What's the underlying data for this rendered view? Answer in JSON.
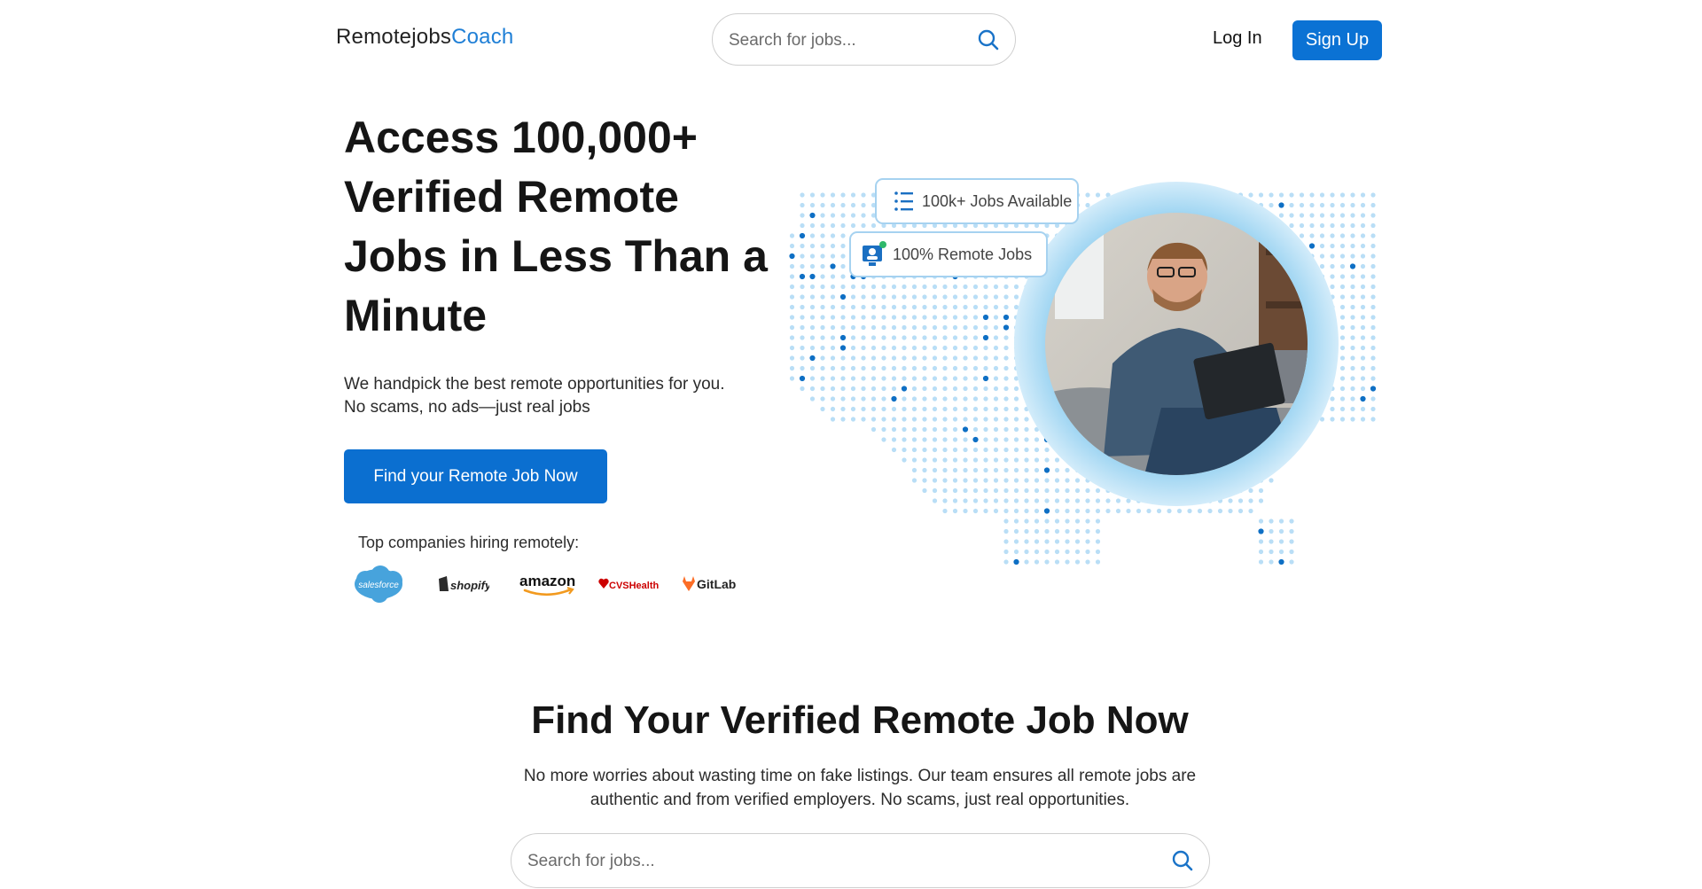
{
  "header": {
    "logo_part1": "Remotejobs",
    "logo_part2": "Coach",
    "search_placeholder": "Search for jobs...",
    "login_label": "Log In",
    "signup_label": "Sign Up"
  },
  "hero": {
    "title": "Access 100,000+ Verified Remote Jobs in Less Than a Minute",
    "subtitle_line1": "We handpick the best remote opportunities for you.",
    "subtitle_line2": "No scams, no ads—just real jobs",
    "cta_label": "Find your Remote Job Now",
    "companies_label": "Top companies hiring remotely:",
    "companies": [
      "salesforce",
      "shopify",
      "amazon",
      "CVSHealth",
      "GitLab"
    ],
    "badge_jobs": "100k+ Jobs Available",
    "badge_remote": "100% Remote Jobs"
  },
  "section": {
    "title": "Find Your Verified Remote Job Now",
    "text": "No more worries about wasting time on fake listings. Our team ensures all remote jobs are authentic and from verified employers. No scams, just real opportunities.",
    "search_placeholder": "Search for jobs..."
  },
  "colors": {
    "accent": "#0b72d4",
    "logo_accent": "#1f7fd6",
    "map_dot_light": "#b9def6",
    "map_dot_dark": "#0e6fc4"
  },
  "icons": [
    "search-icon",
    "list-icon",
    "remote-user-icon"
  ]
}
